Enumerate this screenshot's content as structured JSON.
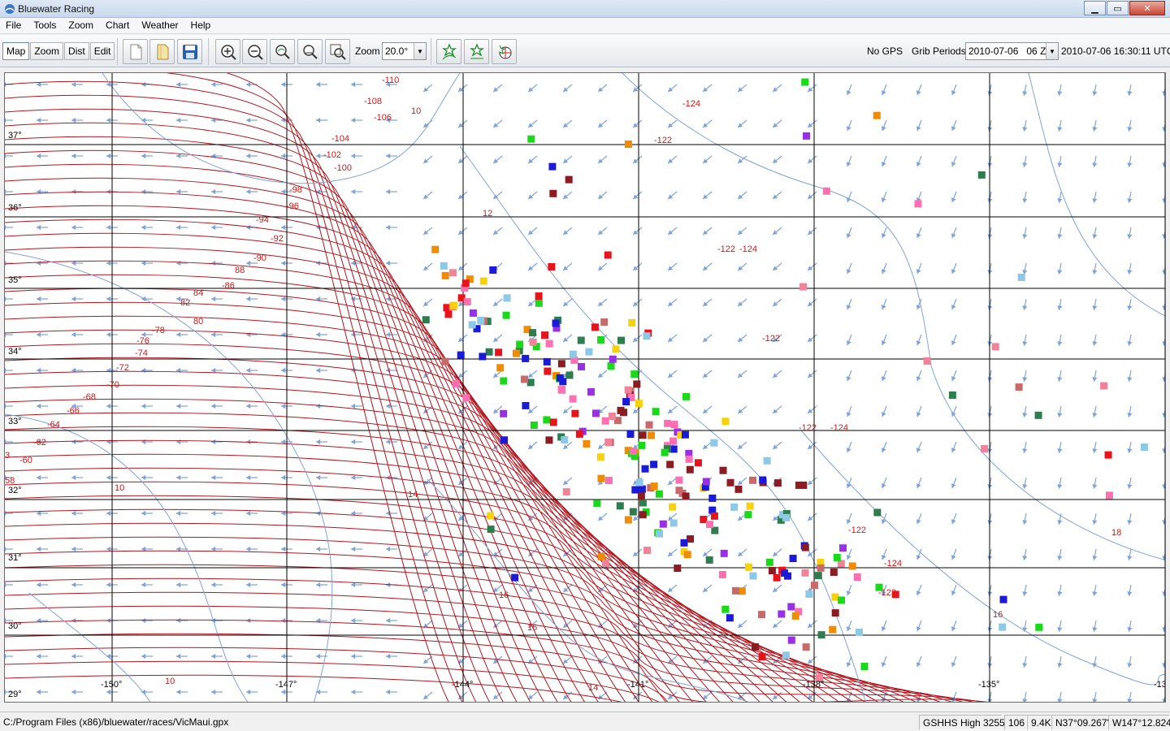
{
  "window": {
    "title": "Bluewater Racing"
  },
  "menu": [
    "File",
    "Tools",
    "Zoom",
    "Chart",
    "Weather",
    "Help"
  ],
  "modes": [
    "Map",
    "Zoom",
    "Dist",
    "Edit"
  ],
  "active_mode": "Map",
  "toolbar": {
    "zoom_label": "Zoom",
    "zoom_value": "20.0°",
    "gps_status": "No GPS",
    "grib_label": "Grib Periods",
    "grib_value": "2010-07-06   06 Z",
    "grib_time": "2010-07-06 16:30:11 UTC"
  },
  "map": {
    "lat_labels": [
      "37°",
      "36°",
      "35°",
      "34°",
      "33°",
      "32°",
      "31°",
      "30°",
      "29°"
    ],
    "lon_labels": [
      "-150°",
      "-147°",
      "-144°",
      "-141°",
      "-138°",
      "-135°",
      "-13"
    ],
    "isobar_labels": [
      "-110",
      "-108",
      "-106",
      "-104",
      "-102",
      "-100",
      "-98",
      "-96",
      "-94",
      "-92",
      "-90",
      "88",
      "-86",
      "84",
      "82",
      "80",
      "-78",
      "-76",
      "-74",
      "-72",
      "-70",
      "-68",
      "-66",
      "-64",
      "-62",
      "-60",
      "58",
      "3",
      "10",
      "10",
      "12",
      "14",
      "14",
      "16",
      "16",
      "16",
      "18",
      "10",
      "-124",
      "-122",
      "-122",
      "-124",
      "-122",
      "-122",
      "-124",
      "-122",
      "-124",
      "-122"
    ],
    "colors": {
      "isobar": "#b0161e",
      "wind": "#7fa3d9",
      "grid": "#000000",
      "label": "#c81a1a"
    }
  },
  "status": {
    "path": "C:/Program Files (x86)/bluewater/races/VicMaui.gpx",
    "shoreline": "GSHHS High 3255",
    "count": "106",
    "size": "9.4K",
    "lat": "N37°09.267'",
    "lon": "W147°12.824'"
  }
}
